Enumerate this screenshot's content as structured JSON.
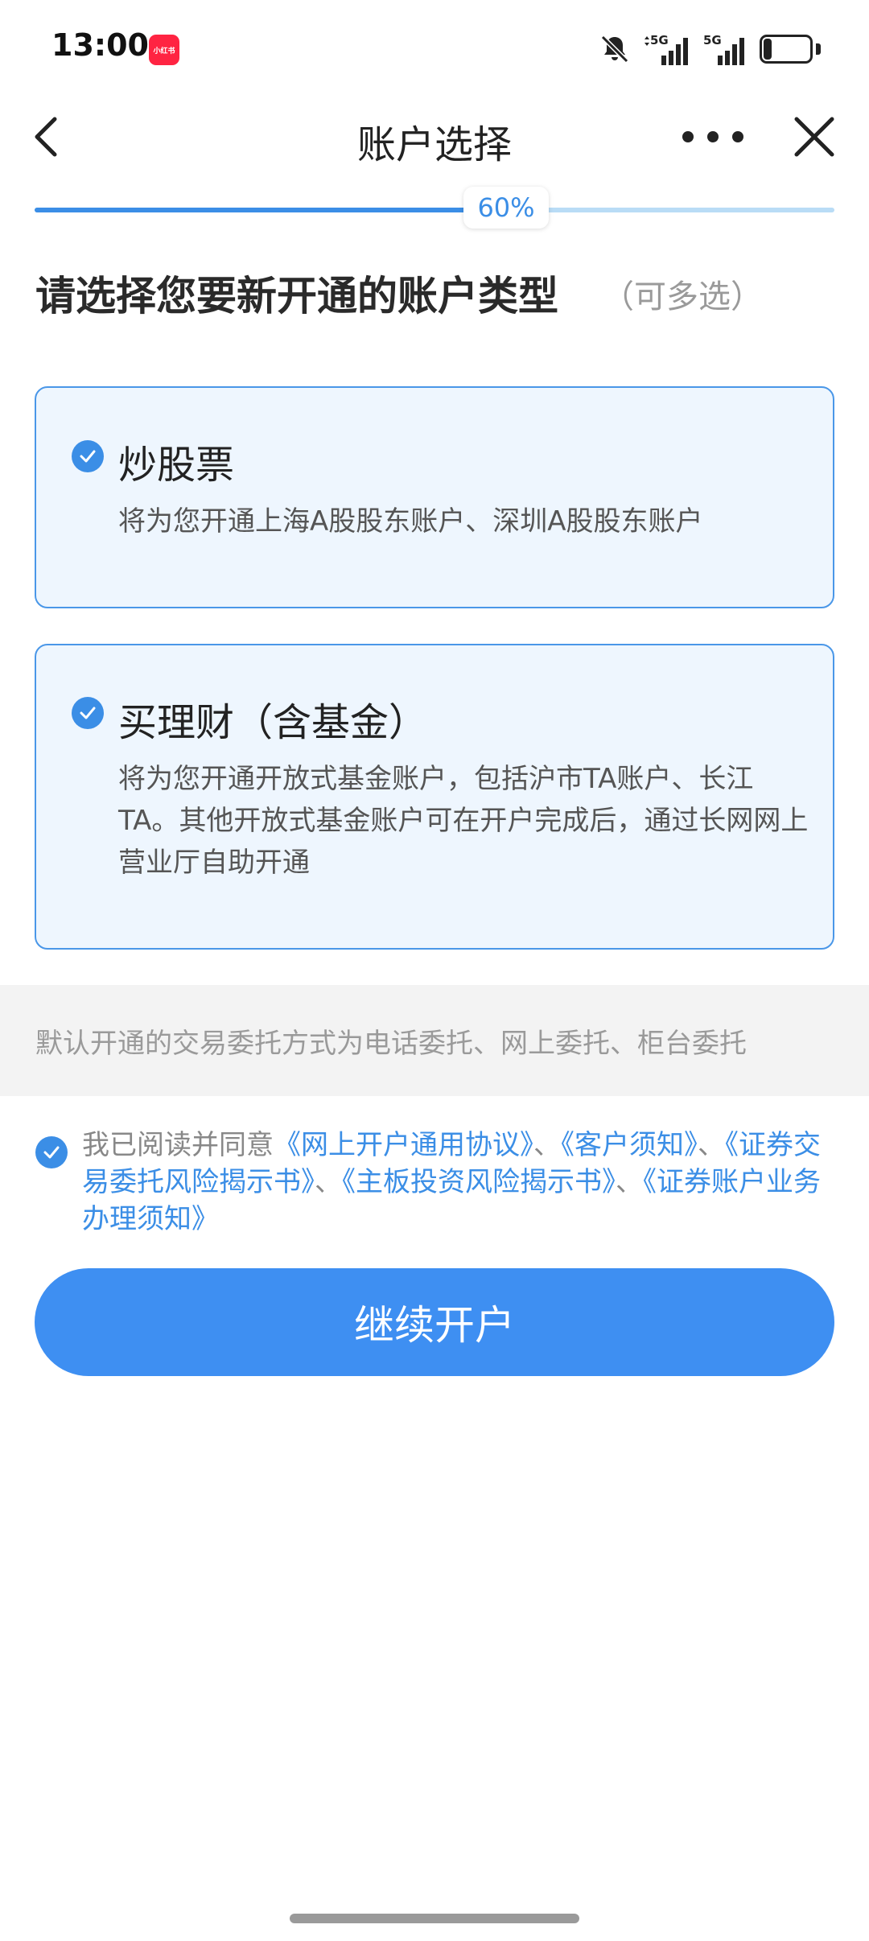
{
  "status_bar": {
    "time": "13:00",
    "app_badge": "小红书",
    "signal_1": "5G",
    "signal_2": "5G",
    "battery": "23",
    "battery_level": 0.23
  },
  "nav": {
    "title": "账户选择",
    "back_icon": "chevron-left-icon",
    "more_icon": "more-dots-icon",
    "close_icon": "close-icon"
  },
  "progress": {
    "label": "60%",
    "value": 0.6
  },
  "heading": {
    "title": "请选择您要新开通的账户类型",
    "hint": "（可多选）"
  },
  "options": [
    {
      "title": "炒股票",
      "description": "将为您开通上海A股股东账户、深圳A股股东账户",
      "checked": true
    },
    {
      "title": "买理财（含基金）",
      "description": "将为您开通开放式基金账户，包括沪市TA账户、长江TA。其他开放式基金账户可在开户完成后，通过长网网上营业厅自助开通",
      "checked": true
    }
  ],
  "info": {
    "text": "默认开通的交易委托方式为电话委托、网上委托、柜台委托"
  },
  "agreement": {
    "checked": true,
    "prefix": "我已阅读并同意",
    "links": [
      "《网上开户通用协议》",
      "《客户须知》",
      "《证券交易委托风险揭示书》",
      "《主板投资风险揭示书》",
      "《证券账户业务办理须知》"
    ],
    "separator": "、"
  },
  "primary_button": {
    "label": "继续开户"
  },
  "colors": {
    "accent": "#3b8ee6",
    "button": "#3e8ff2",
    "card_bg": "#eef6fe",
    "card_border": "#4a97e8"
  }
}
